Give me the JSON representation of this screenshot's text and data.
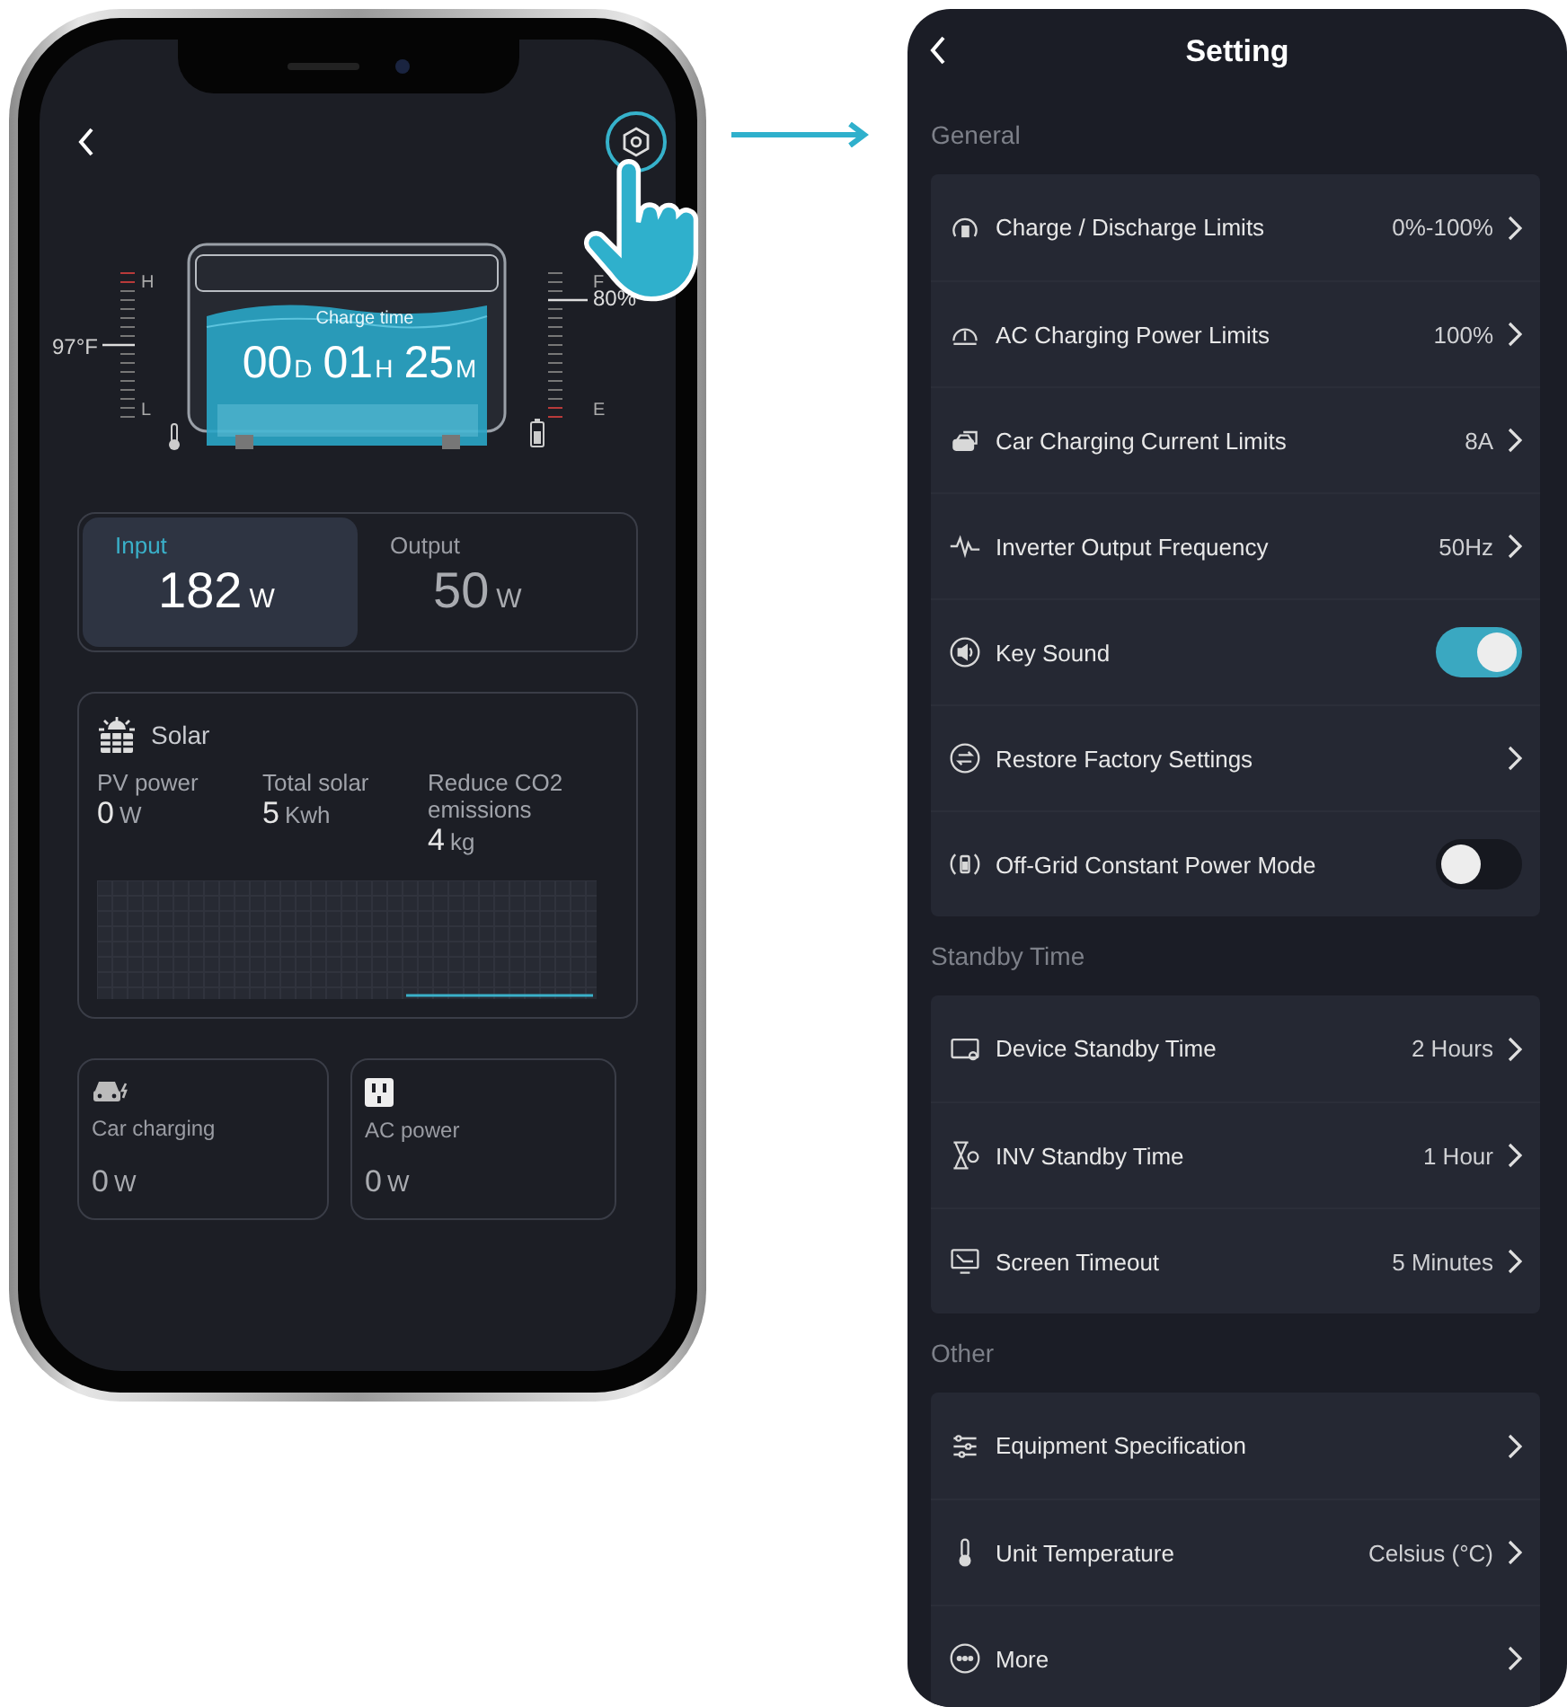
{
  "device_screen": {
    "charge_label": "Charge time",
    "charge_time": [
      {
        "value": "00",
        "unit": "D"
      },
      {
        "value": "01",
        "unit": "H"
      },
      {
        "value": "25",
        "unit": "M"
      }
    ],
    "temperature": "97°F",
    "temp_scale": [
      "H",
      "L"
    ],
    "battery_scale": [
      "F",
      "E"
    ],
    "battery_reading": "80%",
    "power_tabs": [
      {
        "label": "Input",
        "value": "182",
        "unit": "W",
        "selected": true
      },
      {
        "label": "Output",
        "value": "50",
        "unit": "W",
        "selected": false
      }
    ],
    "solar": {
      "title": "Solar",
      "stats": [
        {
          "label": "PV power",
          "value": "0",
          "unit": "W"
        },
        {
          "label": "Total solar",
          "value": "5",
          "unit": "Kwh"
        },
        {
          "label": "Reduce CO2 emissions",
          "value": "4",
          "unit": "kg"
        }
      ]
    },
    "outputs": [
      {
        "kind": "car",
        "label": "Car charging",
        "value": "0",
        "unit": "W"
      },
      {
        "kind": "ac",
        "label": "AC power",
        "value": "0",
        "unit": "W"
      }
    ]
  },
  "settings": {
    "title": "Setting",
    "sections": [
      {
        "title": "General",
        "items": [
          {
            "kind": "value",
            "label": "Charge / Discharge Limits",
            "value": "0%-100%"
          },
          {
            "kind": "value",
            "label": "AC Charging Power Limits",
            "value": "100%"
          },
          {
            "kind": "value",
            "label": "Car Charging Current Limits",
            "value": "8A"
          },
          {
            "kind": "value",
            "label": "Inverter Output Frequency",
            "value": "50Hz"
          },
          {
            "kind": "toggle",
            "label": "Key Sound",
            "on": true
          },
          {
            "kind": "link",
            "label": "Restore Factory Settings"
          },
          {
            "kind": "toggle",
            "label": "Off-Grid Constant Power Mode",
            "on": false
          }
        ]
      },
      {
        "title": "Standby Time",
        "items": [
          {
            "kind": "value",
            "label": "Device Standby Time",
            "value": "2 Hours"
          },
          {
            "kind": "value",
            "label": "INV Standby Time",
            "value": "1 Hour"
          },
          {
            "kind": "value",
            "label": "Screen Timeout",
            "value": "5 Minutes"
          }
        ]
      },
      {
        "title": "Other",
        "items": [
          {
            "kind": "link",
            "label": "Equipment Specification"
          },
          {
            "kind": "value",
            "label": "Unit Temperature",
            "value": "Celsius (°C)"
          },
          {
            "kind": "link",
            "label": "More"
          }
        ]
      }
    ]
  }
}
